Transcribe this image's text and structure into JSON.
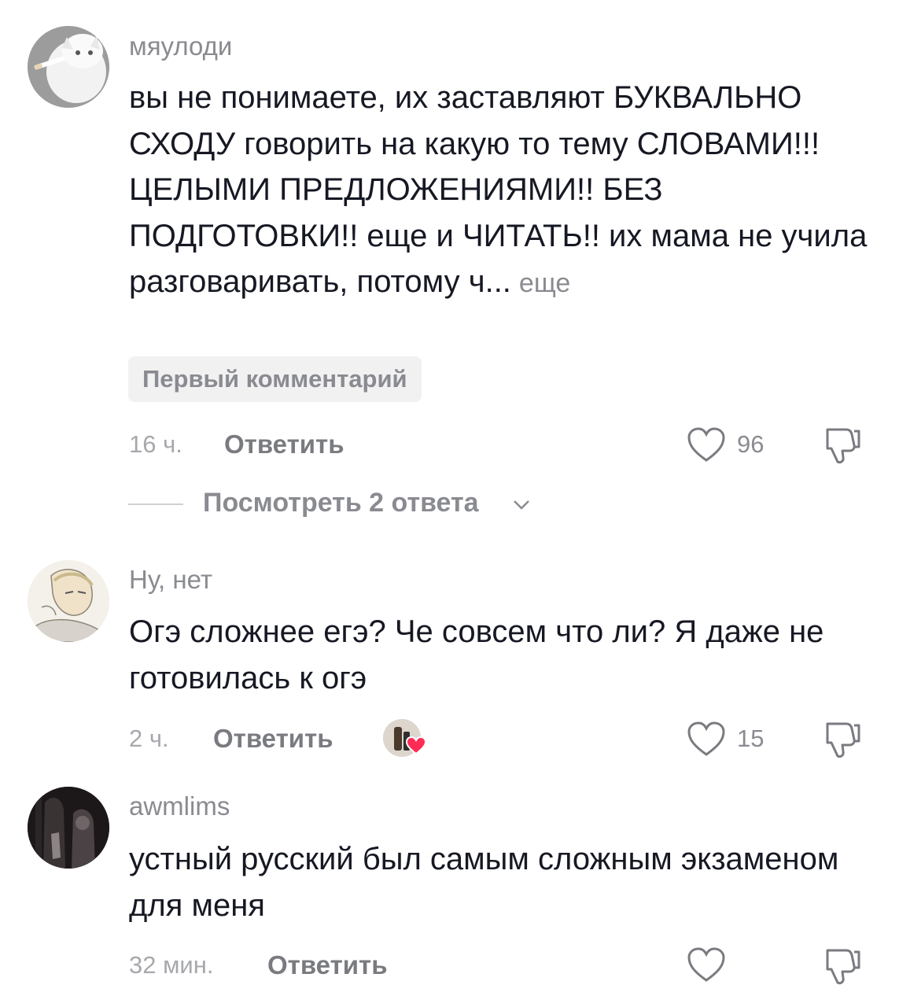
{
  "comments": [
    {
      "username": "мяулоди",
      "text": "вы не понимаете, их заставляют БУКВАЛЬНО СХОДУ говорить на какую то тему СЛОВАМИ!!! ЦЕЛЫМИ ПРЕДЛОЖЕНИЯМИ!! БЕЗ ПОДГОТОВКИ!! еще и ЧИТАТЬ!! их мама не учила разговаривать, потому ч...",
      "more_label": "еще",
      "badge": "Первый комментарий",
      "time": "16 ч.",
      "reply_label": "Ответить",
      "likes": "96",
      "view_replies": "Посмотреть 2 ответа"
    },
    {
      "username": "Ну, нет",
      "text": "Огэ сложнее егэ? Че совсем что ли? Я даже не готовилась к огэ",
      "time": "2 ч.",
      "reply_label": "Ответить",
      "likes": "15"
    },
    {
      "username": "awmlims",
      "text": "устный русский был самым сложным экзаменом для меня",
      "time": "32 мин.",
      "reply_label": "Ответить",
      "likes": ""
    }
  ],
  "icons": {
    "like": "heart-outline-icon",
    "dislike": "thumbs-down-icon",
    "expand": "chevron-down-icon",
    "creator_liked": "heart-filled-icon"
  },
  "colors": {
    "text": "#161823",
    "muted": "#8a8b91",
    "badge_bg": "#f1f1f2",
    "creator_heart": "#fe2c55"
  }
}
